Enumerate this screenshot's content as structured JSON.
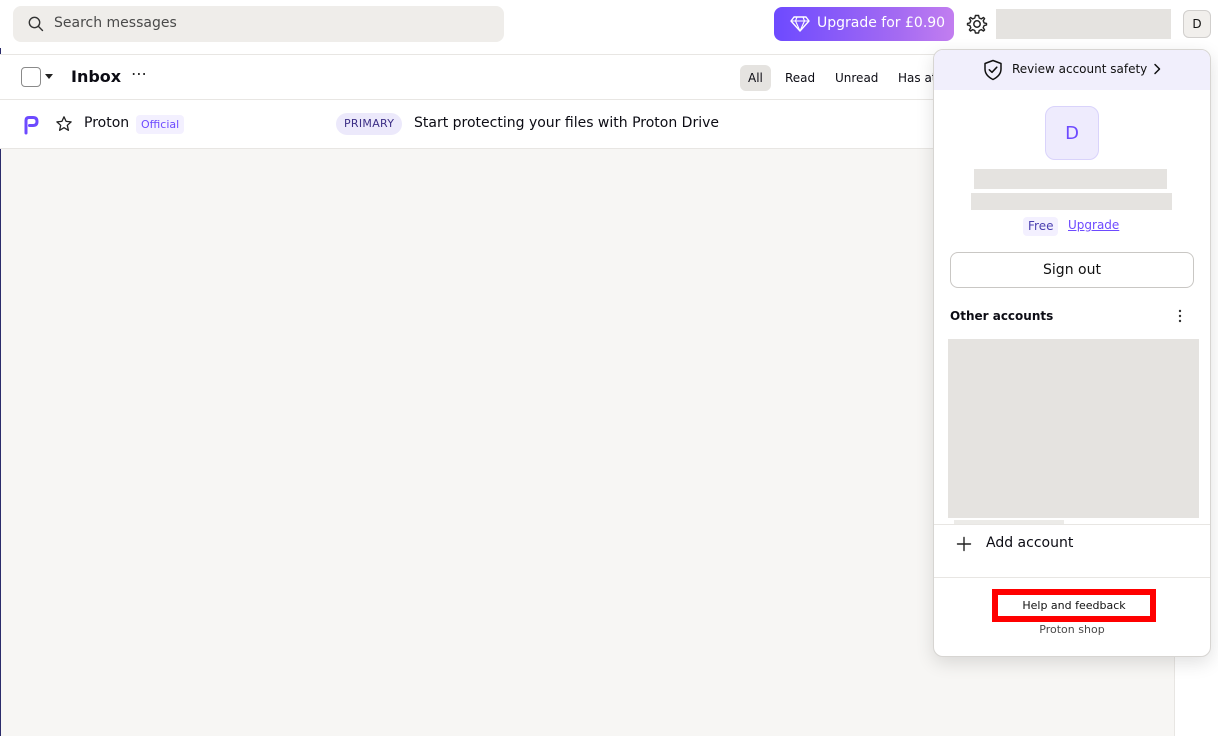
{
  "header": {
    "search_placeholder": "Search messages",
    "upgrade_label": "Upgrade for £0.90",
    "avatar_initial": "D"
  },
  "toolbar": {
    "title": "Inbox",
    "more": "⋯",
    "filters": [
      "All",
      "Read",
      "Unread",
      "Has at"
    ]
  },
  "messages": [
    {
      "sender": "Proton",
      "badge": "Official",
      "label": "PRIMARY",
      "subject": "Start protecting your files with Proton Drive"
    }
  ],
  "account_menu": {
    "review_safety": "Review account safety",
    "avatar_initial": "D",
    "plan": "Free",
    "upgrade_link": "Upgrade",
    "sign_out": "Sign out",
    "other_accounts_title": "Other accounts",
    "add_account": "Add account",
    "help_feedback": "Help and feedback",
    "proton_shop": "Proton shop"
  },
  "colors": {
    "accent": "#6d4aff",
    "highlight_border": "#ff0000"
  }
}
